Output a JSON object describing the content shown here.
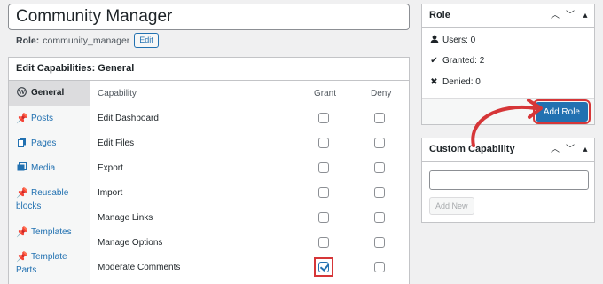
{
  "role_title": "Community Manager",
  "role_line": {
    "label": "Role:",
    "value": "community_manager",
    "edit_label": "Edit"
  },
  "capabilities": {
    "heading": "Edit Capabilities: General",
    "columns": {
      "capability": "Capability",
      "grant": "Grant",
      "deny": "Deny"
    },
    "categories": [
      {
        "label": "General",
        "icon": "wordpress-icon",
        "active": true
      },
      {
        "label": "Posts",
        "icon": "pin-icon"
      },
      {
        "label": "Pages",
        "icon": "pages-icon"
      },
      {
        "label": "Media",
        "icon": "media-icon"
      },
      {
        "label": "Reusable blocks",
        "icon": "pin-icon"
      },
      {
        "label": "Templates",
        "icon": "pin-icon"
      },
      {
        "label": "Template Parts",
        "icon": "pin-icon"
      }
    ],
    "rows": [
      {
        "name": "Edit Dashboard",
        "grant": false,
        "deny": false
      },
      {
        "name": "Edit Files",
        "grant": false,
        "deny": false
      },
      {
        "name": "Export",
        "grant": false,
        "deny": false
      },
      {
        "name": "Import",
        "grant": false,
        "deny": false
      },
      {
        "name": "Manage Links",
        "grant": false,
        "deny": false
      },
      {
        "name": "Manage Options",
        "grant": false,
        "deny": false
      },
      {
        "name": "Moderate Comments",
        "grant": true,
        "deny": false,
        "highlighted": true
      }
    ]
  },
  "role_box": {
    "title": "Role",
    "users": "Users: 0",
    "granted": "Granted: 2",
    "denied": "Denied: 0",
    "add_role_label": "Add Role"
  },
  "custom_capability": {
    "title": "Custom Capability",
    "input_value": "",
    "add_new_label": "Add New"
  },
  "colors": {
    "accent": "#2271b1",
    "highlight": "#d63638"
  }
}
